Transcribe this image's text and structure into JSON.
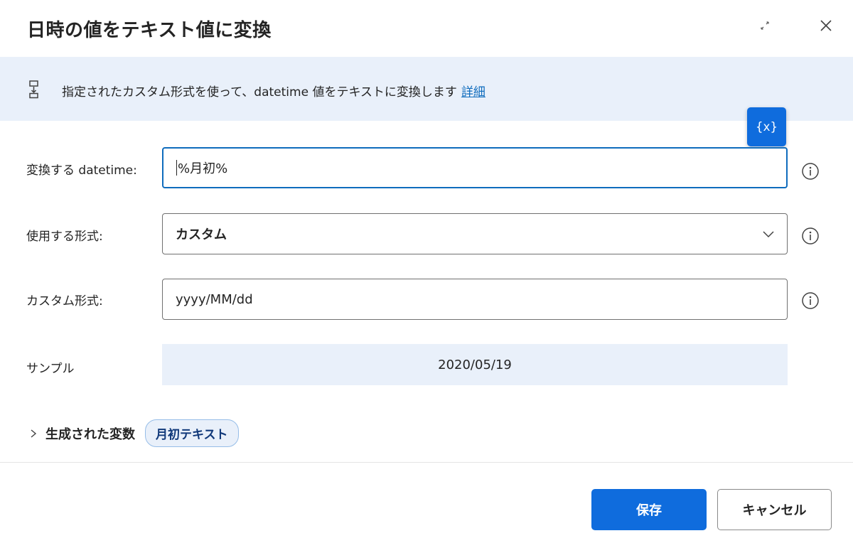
{
  "dialog": {
    "title": "日時の値をテキスト値に変換",
    "expand_icon": "expand-icon",
    "close_icon": "close-icon"
  },
  "banner": {
    "text": "指定されたカスタム形式を使って、datetime 値をテキストに変換します",
    "link": "詳細",
    "icon": "action-info-icon"
  },
  "variable_button": {
    "label": "{x}"
  },
  "fields": {
    "datetime": {
      "label": "変換する datetime:",
      "value": "%月初%"
    },
    "format": {
      "label": "使用する形式:",
      "value": "カスタム"
    },
    "custom_format": {
      "label": "カスタム形式:",
      "value": "yyyy/MM/dd"
    },
    "sample": {
      "label": "サンプル",
      "value": "2020/05/19"
    }
  },
  "generated": {
    "label": "生成された変数",
    "variable": "月初テキスト"
  },
  "footer": {
    "save_label": "保存",
    "cancel_label": "キャンセル"
  },
  "colors": {
    "accent": "#0f6cdd",
    "banner_bg": "#e9f0fa",
    "link": "#0f6cbd"
  }
}
